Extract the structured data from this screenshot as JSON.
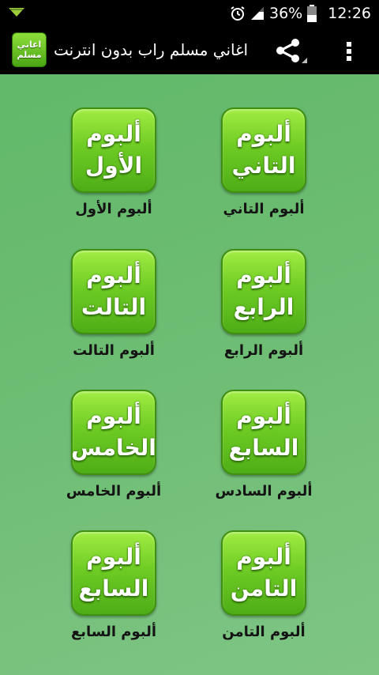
{
  "status_bar": {
    "battery_percent": "36%",
    "time": "12:26",
    "icons": [
      "download-arrow-icon",
      "alarm-icon",
      "signal-icon",
      "battery-icon"
    ]
  },
  "action_bar": {
    "title": "اغاني مسلم راب بدون انترنت",
    "app_icon_lines": [
      "اغاني",
      "مسلم"
    ],
    "share_icon": "share-icon",
    "overflow_icon": "overflow-menu-icon"
  },
  "albums": [
    {
      "tile": [
        "ألبوم",
        "التاني"
      ],
      "caption": "ألبوم التاني"
    },
    {
      "tile": [
        "ألبوم",
        "الأول"
      ],
      "caption": "ألبوم الأول"
    },
    {
      "tile": [
        "ألبوم",
        "الرابع"
      ],
      "caption": "ألبوم الرابع"
    },
    {
      "tile": [
        "ألبوم",
        "التالت"
      ],
      "caption": "ألبوم التالت"
    },
    {
      "tile": [
        "ألبوم",
        "السابع"
      ],
      "caption": "ألبوم السادس"
    },
    {
      "tile": [
        "ألبوم",
        "الخامس"
      ],
      "caption": "ألبوم الخامس"
    },
    {
      "tile": [
        "ألبوم",
        "التامن"
      ],
      "caption": "ألبوم التامن"
    },
    {
      "tile": [
        "ألبوم",
        "السابع"
      ],
      "caption": "ألبوم السابع"
    }
  ],
  "colors": {
    "background": "#6cbc72",
    "tile_green": "#6fcc24",
    "bar_black": "#000000"
  }
}
